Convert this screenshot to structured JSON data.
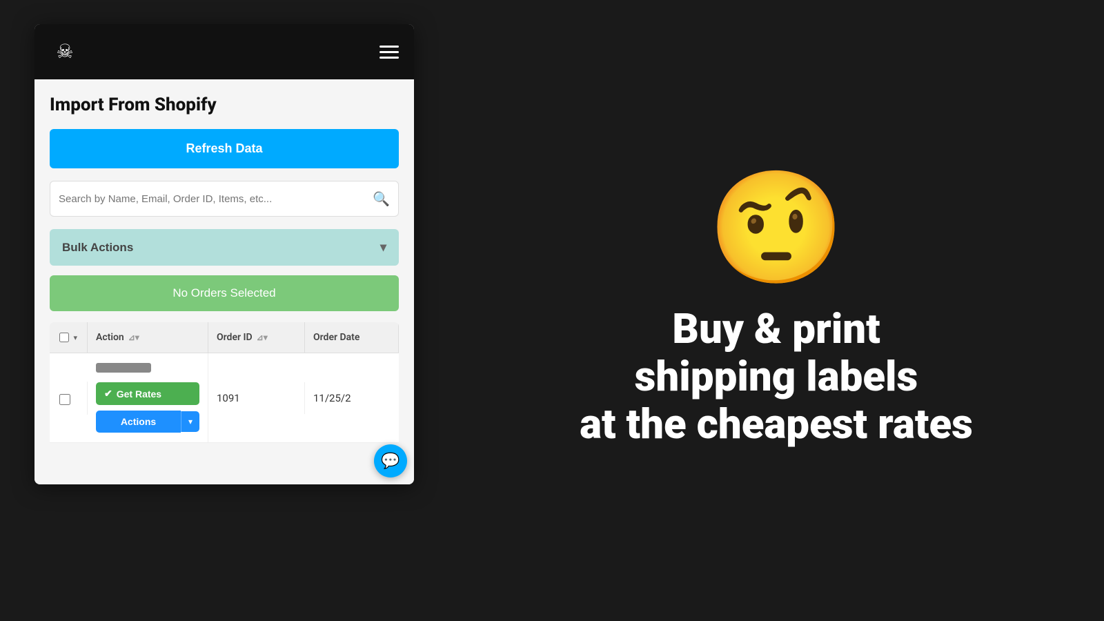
{
  "nav": {
    "logo_symbol": "☠",
    "hamburger_label": "Menu"
  },
  "page": {
    "title": "Import From Shopify",
    "refresh_btn_label": "Refresh Data",
    "search_placeholder": "Search by Name, Email, Order ID, Items, etc...",
    "bulk_actions_label": "Bulk Actions",
    "no_orders_label": "No Orders Selected"
  },
  "table": {
    "columns": [
      {
        "label": "Action",
        "id": "action"
      },
      {
        "label": "Order ID",
        "id": "order_id"
      },
      {
        "label": "Order Date",
        "id": "order_date"
      }
    ],
    "rows": [
      {
        "order_id": "1091",
        "order_date": "11/25/2",
        "get_rates_label": "Get Rates",
        "actions_label": "Actions"
      }
    ]
  },
  "promo": {
    "emoji": "🤨",
    "line1": "Buy & print",
    "line2": "shipping labels",
    "line3": "at the cheapest rates"
  },
  "chat": {
    "icon": "💬"
  }
}
